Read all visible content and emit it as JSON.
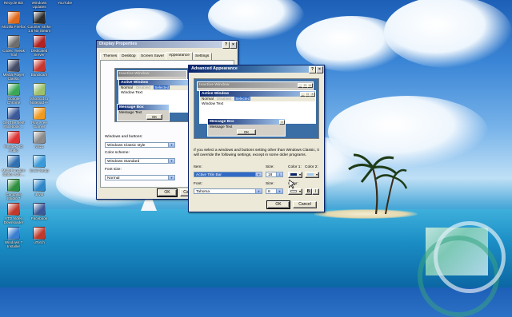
{
  "desktop": {
    "icons": [
      {
        "label": "Recycle Bin",
        "color": "#8fb3d9",
        "col": 0,
        "row": -1
      },
      {
        "label": "Windows Updates",
        "color": "#3a7ed0",
        "col": 1,
        "row": -1
      },
      {
        "label": "YouTube",
        "color": "#d23c2c",
        "col": 2,
        "row": -1
      },
      {
        "label": "Mozilla Firefox",
        "color": "#e06a1c",
        "col": 0,
        "row": 0
      },
      {
        "label": "Counter Strike 1.6 No Steam",
        "color": "#2b2b2b",
        "col": 1,
        "row": 0
      },
      {
        "label": "Codec Tweak Tool",
        "color": "#6d6d6d",
        "col": 0,
        "row": 1
      },
      {
        "label": "Dedicated Server",
        "color": "#b22222",
        "col": 1,
        "row": 1
      },
      {
        "label": "Media Player Classic",
        "color": "#444c66",
        "col": 0,
        "row": 2
      },
      {
        "label": "Bandicam",
        "color": "#c8372f",
        "col": 1,
        "row": 2
      },
      {
        "label": "Google Chrome",
        "color": "#3aa757",
        "col": 0,
        "row": 3
      },
      {
        "label": "Shortcut to Notepad++",
        "color": "#9cc06c",
        "col": 1,
        "row": 3
      },
      {
        "label": "Get The Best Facebook ...",
        "color": "#3b5998",
        "col": 0,
        "row": 4
      },
      {
        "label": "Play Free Games",
        "color": "#f29a20",
        "col": 1,
        "row": 4
      },
      {
        "label": "Realtek HD Audio",
        "color": "#d33",
        "col": 0,
        "row": 5
      },
      {
        "label": "NS21",
        "color": "#8a8a8a",
        "col": 1,
        "row": 5
      },
      {
        "label": "Multi-Function Station soft ...",
        "color": "#3070b0",
        "col": 0,
        "row": 6
      },
      {
        "label": "iLivid Setup",
        "color": "#3a9ad9",
        "col": 1,
        "row": 6
      },
      {
        "label": "Camtasia Studio 7",
        "color": "#2f8f3e",
        "col": 0,
        "row": 7
      },
      {
        "label": "iLivid",
        "color": "#2d87c9",
        "col": 1,
        "row": 7
      },
      {
        "label": "YTD Video Downloader",
        "color": "#c0392b",
        "col": 0,
        "row": 8
      },
      {
        "label": "Facebook",
        "color": "#3b5998",
        "col": 1,
        "row": 8
      },
      {
        "label": "Windows 7 Installer",
        "color": "#3a7ed0",
        "col": 0,
        "row": 9
      },
      {
        "label": "uTorch",
        "color": "#c0392b",
        "col": 1,
        "row": 9
      }
    ]
  },
  "display_properties": {
    "title": "Display Properties",
    "tabs": [
      "Themes",
      "Desktop",
      "Screen Saver",
      "Appearance",
      "Settings"
    ],
    "active_tab": "Appearance",
    "preview": {
      "inactive_title": "Inactive Window",
      "active_title": "Active Window",
      "menu": [
        "Normal",
        "Disabled",
        "Selected"
      ],
      "window_text": "Window Text",
      "message_box_title": "Message Box",
      "message_text": "Message Text",
      "ok": "OK"
    },
    "windows_buttons_label": "Windows and buttons:",
    "windows_buttons_value": "Windows Classic style",
    "color_scheme_label": "Color scheme:",
    "color_scheme_value": "Windows Standard",
    "font_size_label": "Font size:",
    "font_size_value": "Normal",
    "ok": "OK",
    "cancel": "Cancel"
  },
  "advanced_appearance": {
    "title": "Advanced Appearance",
    "preview": {
      "inactive_title": "Inactive Window",
      "active_title": "Active Window",
      "menu": [
        "Normal",
        "Disabled",
        "Selected"
      ],
      "window_text": "Window Text",
      "message_box_title": "Message Box",
      "message_text": "Message Text",
      "ok": "OK"
    },
    "info_text": "If you select a windows and buttons setting other than Windows Classic, it will override the following settings, except in some older programs.",
    "item_label": "Item:",
    "item_value": "Active Title Bar",
    "size_label": "Size:",
    "size_value": "18",
    "color1_label": "Color 1:",
    "color2_label": "Color 2:",
    "font_label": "Font:",
    "font_value": "Tahoma",
    "font_size_label": "Size:",
    "font_size_value": "8",
    "font_color_label": "Color:",
    "bold": "B",
    "italic": "I",
    "ok": "OK",
    "cancel": "Cancel",
    "color1_hex": "#0a246a",
    "color2_hex": "#a6caf0"
  }
}
